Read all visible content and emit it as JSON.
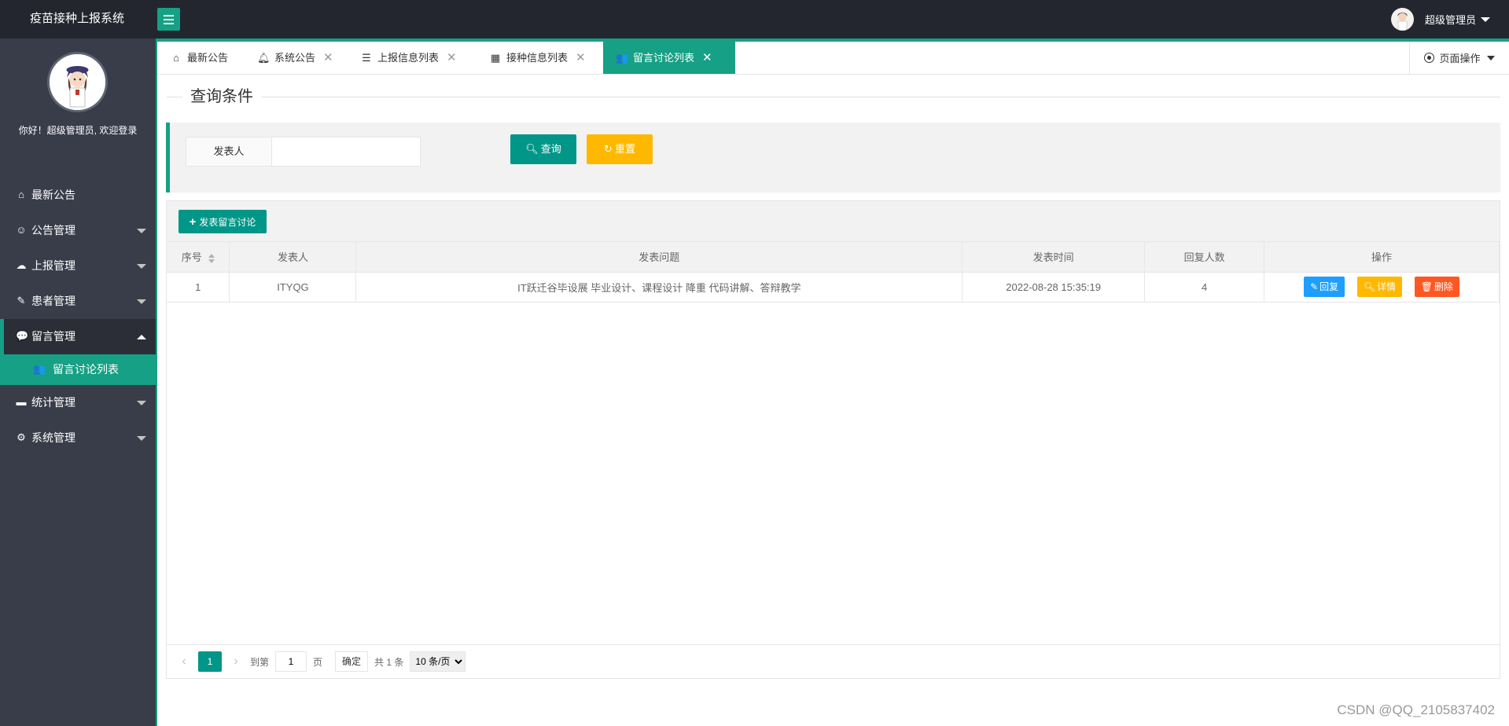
{
  "header": {
    "app_title": "疫苗接种上报系统",
    "user_name": "超级管理员"
  },
  "sidebar": {
    "welcome": "你好！超级管理员, 欢迎登录",
    "items": [
      {
        "label": "最新公告",
        "icon": "home-icon"
      },
      {
        "label": "公告管理",
        "icon": "smile-icon"
      },
      {
        "label": "上报管理",
        "icon": "cloud-upload-icon"
      },
      {
        "label": "患者管理",
        "icon": "edit-icon"
      },
      {
        "label": "留言管理",
        "icon": "chat-icon"
      },
      {
        "label": "统计管理",
        "icon": "screen-icon"
      },
      {
        "label": "系统管理",
        "icon": "gear-icon"
      }
    ],
    "sub_item": {
      "label": "留言讨论列表",
      "icon": "users-icon"
    }
  },
  "tabs": [
    {
      "label": "最新公告",
      "icon": "home-icon"
    },
    {
      "label": "系统公告",
      "icon": "bell-icon"
    },
    {
      "label": "上报信息列表",
      "icon": "list-icon"
    },
    {
      "label": "接种信息列表",
      "icon": "table-icon"
    },
    {
      "label": "留言讨论列表",
      "icon": "users-icon"
    }
  ],
  "page_ops": "页面操作",
  "query": {
    "title": "查询条件",
    "author_label": "发表人",
    "author_value": "",
    "search_label": "查询",
    "reset_label": "重置"
  },
  "toolbar": {
    "add_label": "发表留言讨论"
  },
  "table": {
    "headers": [
      "序号",
      "发表人",
      "发表问题",
      "发表时间",
      "回复人数",
      "操作"
    ],
    "rows": [
      {
        "index": "1",
        "author": "ITYQG",
        "question": "IT跃迁谷毕设展 毕业设计、课程设计 降重 代码讲解、答辩教学",
        "time": "2022-08-28 15:35:19",
        "replies": "4"
      }
    ],
    "actions": {
      "reply": "回复",
      "detail": "详情",
      "delete": "删除"
    }
  },
  "pager": {
    "current": "1",
    "goto_label": "到第",
    "goto_value": "1",
    "page_suffix": "页",
    "confirm": "确定",
    "total": "共 1 条",
    "page_size": "10 条/页"
  },
  "watermark": "CSDN @QQ_2105837402",
  "colors": {
    "accent": "#16a085",
    "dark": "#23262e",
    "sidebar": "#393d49",
    "reply": "#1e9fff",
    "detail": "#ffb800",
    "delete": "#ff5722"
  }
}
